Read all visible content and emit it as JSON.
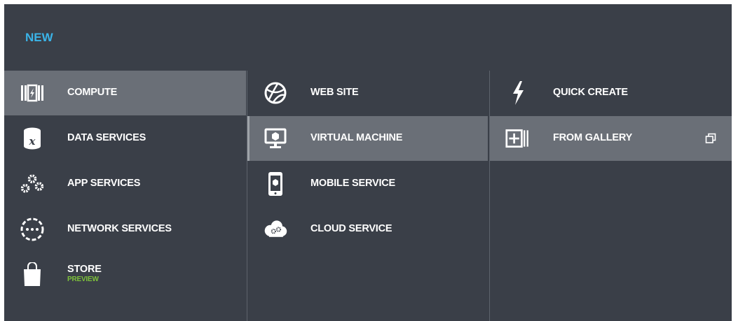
{
  "header": {
    "title": "NEW"
  },
  "col1": {
    "items": [
      {
        "label": "COMPUTE",
        "icon": "compute-icon",
        "selected": true
      },
      {
        "label": "DATA SERVICES",
        "icon": "data-services-icon"
      },
      {
        "label": "APP SERVICES",
        "icon": "app-services-icon"
      },
      {
        "label": "NETWORK SERVICES",
        "icon": "network-services-icon"
      },
      {
        "label": "STORE",
        "sublabel": "PREVIEW",
        "icon": "store-icon"
      }
    ]
  },
  "col2": {
    "items": [
      {
        "label": "WEB SITE",
        "icon": "web-site-icon"
      },
      {
        "label": "VIRTUAL MACHINE",
        "icon": "virtual-machine-icon",
        "selected": true
      },
      {
        "label": "MOBILE SERVICE",
        "icon": "mobile-service-icon"
      },
      {
        "label": "CLOUD SERVICE",
        "icon": "cloud-service-icon"
      }
    ]
  },
  "col3": {
    "items": [
      {
        "label": "QUICK CREATE",
        "icon": "lightning-icon"
      },
      {
        "label": "FROM GALLERY",
        "icon": "gallery-icon",
        "selected": true,
        "trailing_icon": "popout-icon"
      }
    ]
  },
  "colors": {
    "background": "#3a3f48",
    "selected": "#6a6f77",
    "title_accent": "#3ab4e8",
    "preview_accent": "#7ec23b"
  }
}
